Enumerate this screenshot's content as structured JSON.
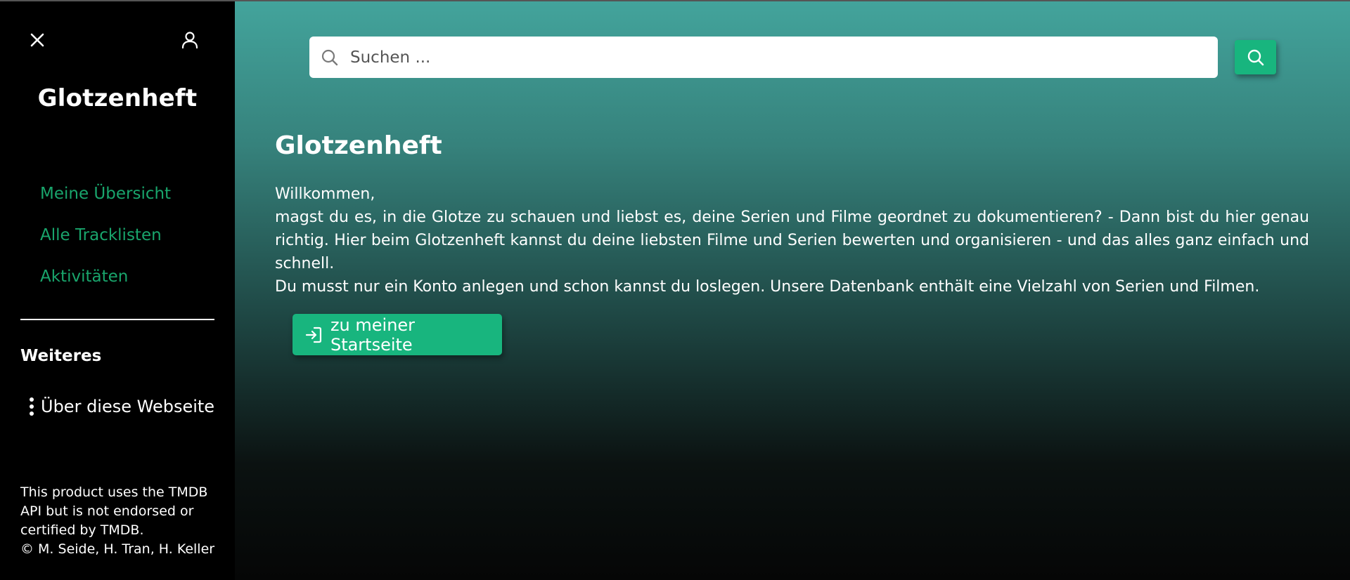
{
  "sidebar": {
    "close_icon": "close-icon",
    "user_icon": "user-icon",
    "brand": "Glotzenheft",
    "nav": [
      {
        "label": "Meine Übersicht"
      },
      {
        "label": "Alle Tracklisten"
      },
      {
        "label": "Aktivitäten"
      }
    ],
    "section_title": "Weiteres",
    "about_label": "Über diese Webseite",
    "footer": {
      "line1": "This product uses the TMDB",
      "line2": "API but is not endorsed or",
      "line3": "certified by TMDB.",
      "line4": "© M. Seide, H. Tran, H. Keller"
    }
  },
  "search": {
    "placeholder": "Suchen ...",
    "value": ""
  },
  "main": {
    "title": "Glotzenheft",
    "welcome": "Willkommen,",
    "paragraph1": "magst du es, in die Glotze zu schauen und liebst es, deine Serien und Filme geordnet zu dokumentieren? - Dann bist du hier genau richtig. Hier beim Glotzenheft kannst du deine liebsten Filme und Serien bewerten und organisieren - und das alles ganz einfach und schnell.",
    "paragraph2": "Du musst nur ein Konto anlegen und schon kannst du loslegen. Unsere Datenbank enthält eine Vielzahl von Serien und Filmen.",
    "start_button": "zu meiner Startseite"
  },
  "colors": {
    "accent": "#18b57e",
    "nav_link": "#19a56c",
    "sidebar_bg": "#000000",
    "gradient_top": "#43a49c",
    "gradient_bottom": "#050606"
  }
}
